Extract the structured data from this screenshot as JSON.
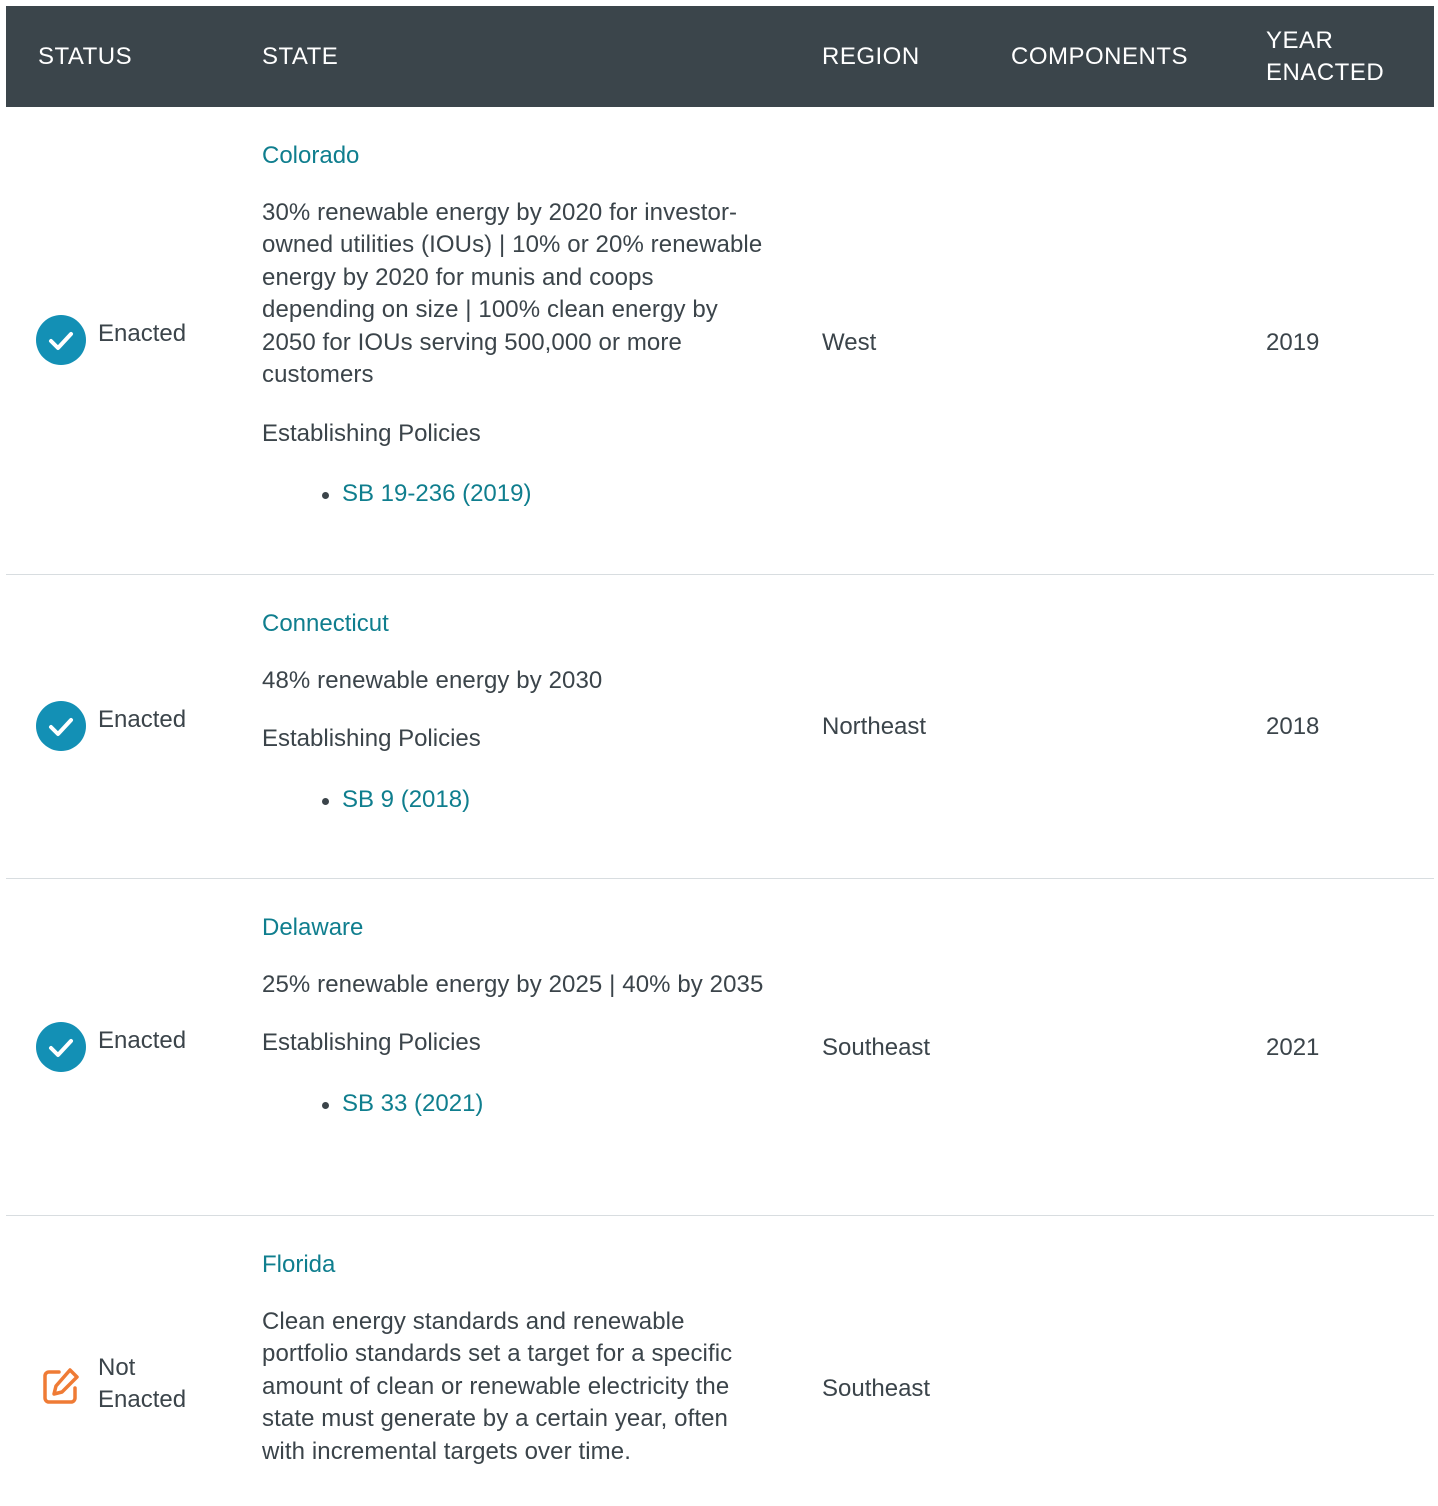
{
  "header": {
    "status": "STATUS",
    "state": "STATE",
    "region": "REGION",
    "components": "COMPONENTS",
    "year_line1": "YEAR",
    "year_line2": "ENACTED"
  },
  "rows": [
    {
      "status": "Enacted",
      "status_icon": "check-circle-icon",
      "state": "Colorado",
      "description": "30% renewable energy by 2020 for investor-owned utilities (IOUs) | 10% or 20% renewable energy by 2020 for munis and coops depending on size | 100% clean energy by 2050 for IOUs serving 500,000 or more customers",
      "establishing_label": "Establishing Policies",
      "policies": [
        "SB 19-236 (2019)"
      ],
      "region": "West",
      "year": "2019"
    },
    {
      "status": "Enacted",
      "status_icon": "check-circle-icon",
      "state": "Connecticut",
      "description": "48% renewable energy by 2030",
      "establishing_label": "Establishing Policies",
      "policies": [
        "SB 9 (2018)"
      ],
      "region": "Northeast",
      "year": "2018"
    },
    {
      "status": "Enacted",
      "status_icon": "check-circle-icon",
      "state": "Delaware",
      "description": "25% renewable energy by 2025 | 40% by 2035",
      "establishing_label": "Establishing Policies",
      "policies": [
        "SB 33 (2021)"
      ],
      "region": "Southeast",
      "year": "2021"
    },
    {
      "status_line1": "Not",
      "status_line2": "Enacted",
      "status_icon": "edit-pencil-icon",
      "state": "Florida",
      "description": "Clean energy standards and renewable portfolio standards set a target for a specific amount of clean or renewable electricity the state must generate by a certain year, often with incremental targets over time.",
      "region": "Southeast",
      "year": ""
    }
  ],
  "colors": {
    "header_bg": "#3b454b",
    "link": "#0f7e8e",
    "enacted_icon": "#1390b5",
    "not_enacted_icon": "#ef7b35",
    "text": "#3b444a",
    "divider": "#d8dde0"
  }
}
